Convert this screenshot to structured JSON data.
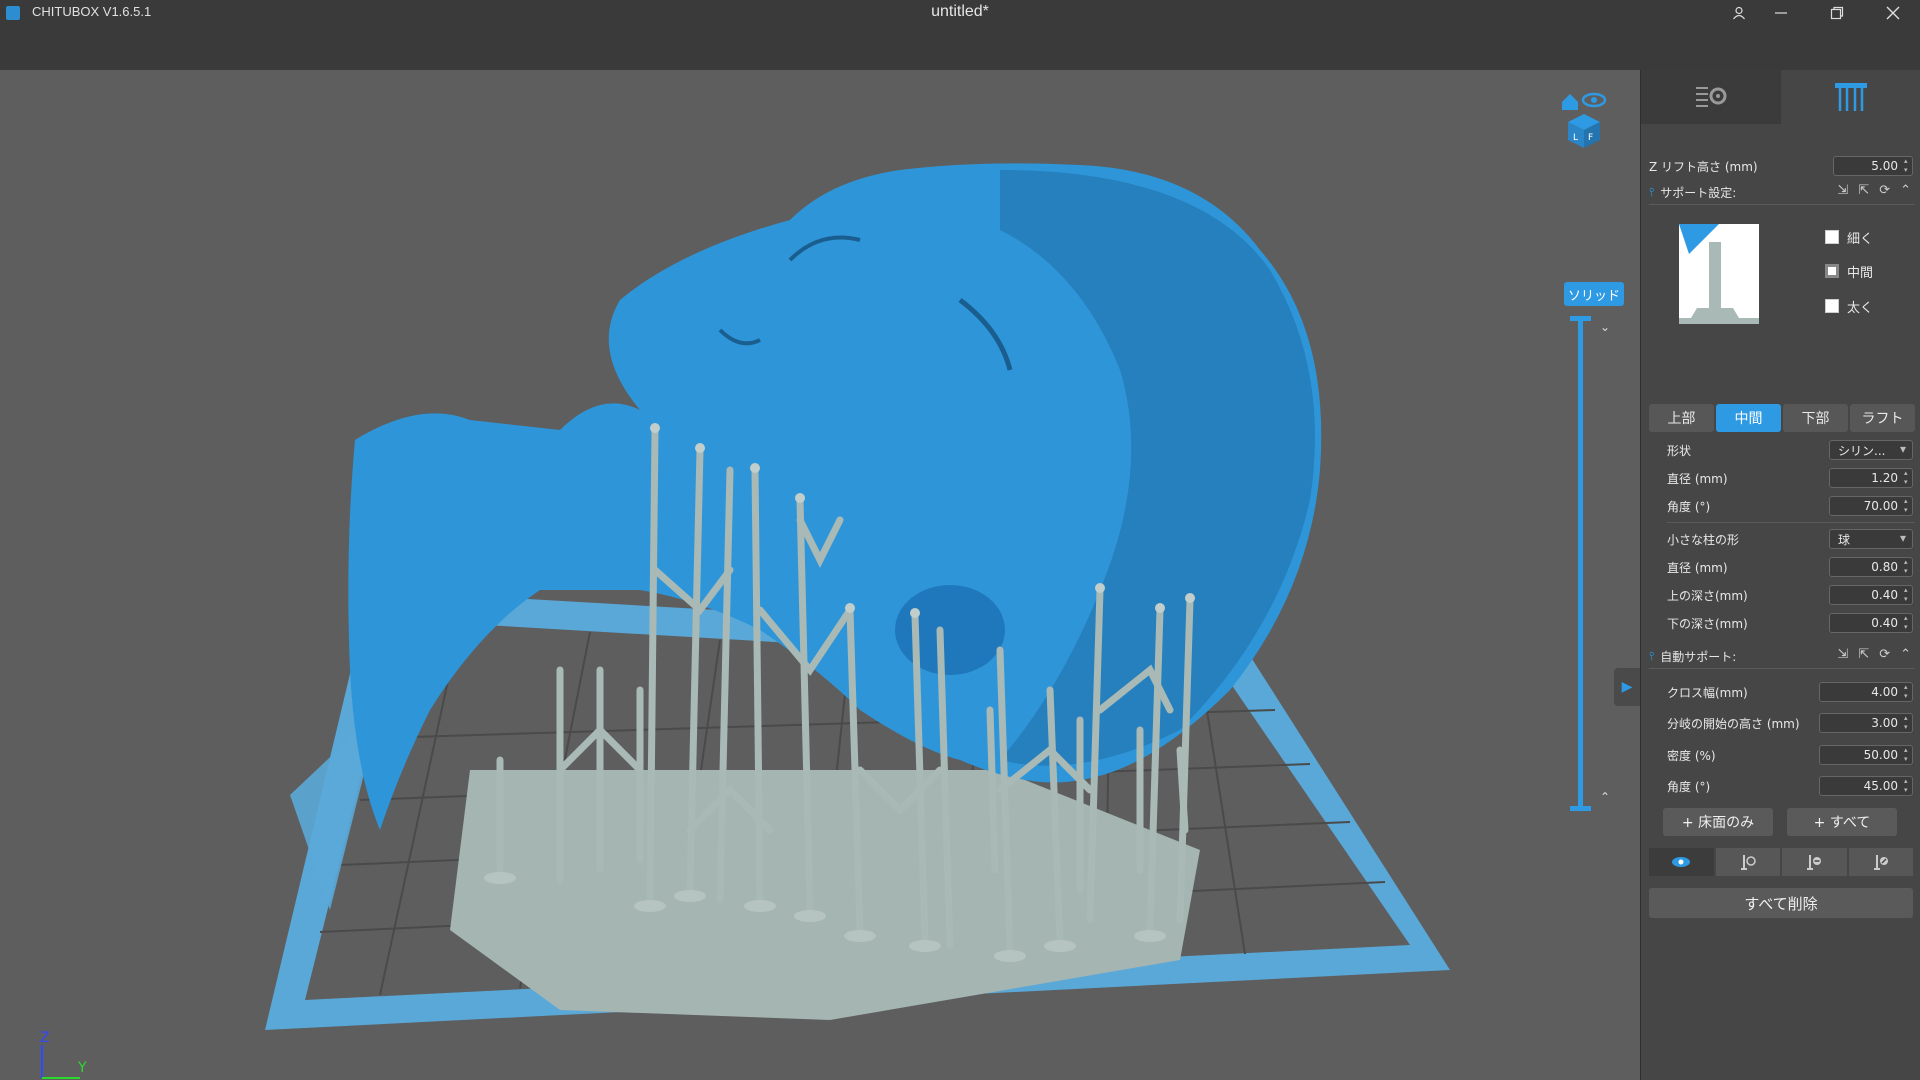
{
  "titlebar": {
    "app_name": "CHITUBOX V1.6.5.1",
    "doc_title": "untitled*"
  },
  "viewport": {
    "render_mode_label": "ソリッド",
    "axis_z": "Z",
    "axis_y": "Y",
    "model_color": "#2e96d8",
    "support_color": "#a9b9b6",
    "plate_color": "#5aa8d8"
  },
  "panel": {
    "tabs": [
      {
        "icon": "slice-settings-icon"
      },
      {
        "icon": "supports-icon"
      }
    ],
    "z_lift": {
      "label": "Z リフト高さ (mm)",
      "value": "5.00"
    },
    "support_settings": {
      "title": "サポート設定:",
      "checkboxes": [
        {
          "label": "細く",
          "checked": false
        },
        {
          "label": "中間",
          "checked": true
        },
        {
          "label": "太く",
          "checked": false
        }
      ],
      "tabs": [
        "上部",
        "中間",
        "下部",
        "ラフト"
      ],
      "active_tab": "中間",
      "shape": {
        "label": "形状",
        "value": "シリン..."
      },
      "diameter": {
        "label": "直径 (mm)",
        "value": "1.20"
      },
      "angle": {
        "label": "角度 (°)",
        "value": "70.00"
      },
      "small_pillar_shape": {
        "label": "小さな柱の形",
        "value": "球"
      },
      "small_diameter": {
        "label": "直径 (mm)",
        "value": "0.80"
      },
      "upper_depth": {
        "label": "上の深さ(mm)",
        "value": "0.40"
      },
      "lower_depth": {
        "label": "下の深さ(mm)",
        "value": "0.40"
      }
    },
    "auto_support": {
      "title": "自動サポート:",
      "cross_width": {
        "label": "クロス幅(mm)",
        "value": "4.00"
      },
      "branch_height": {
        "label": "分岐の開始の高さ (mm)",
        "value": "3.00"
      },
      "density": {
        "label": "密度 (%)",
        "value": "50.00"
      },
      "angle": {
        "label": "角度 (°)",
        "value": "45.00"
      }
    },
    "buttons": {
      "floor_only": "+ 床面のみ",
      "all": "+ すべて",
      "delete_all": "すべて削除"
    }
  }
}
